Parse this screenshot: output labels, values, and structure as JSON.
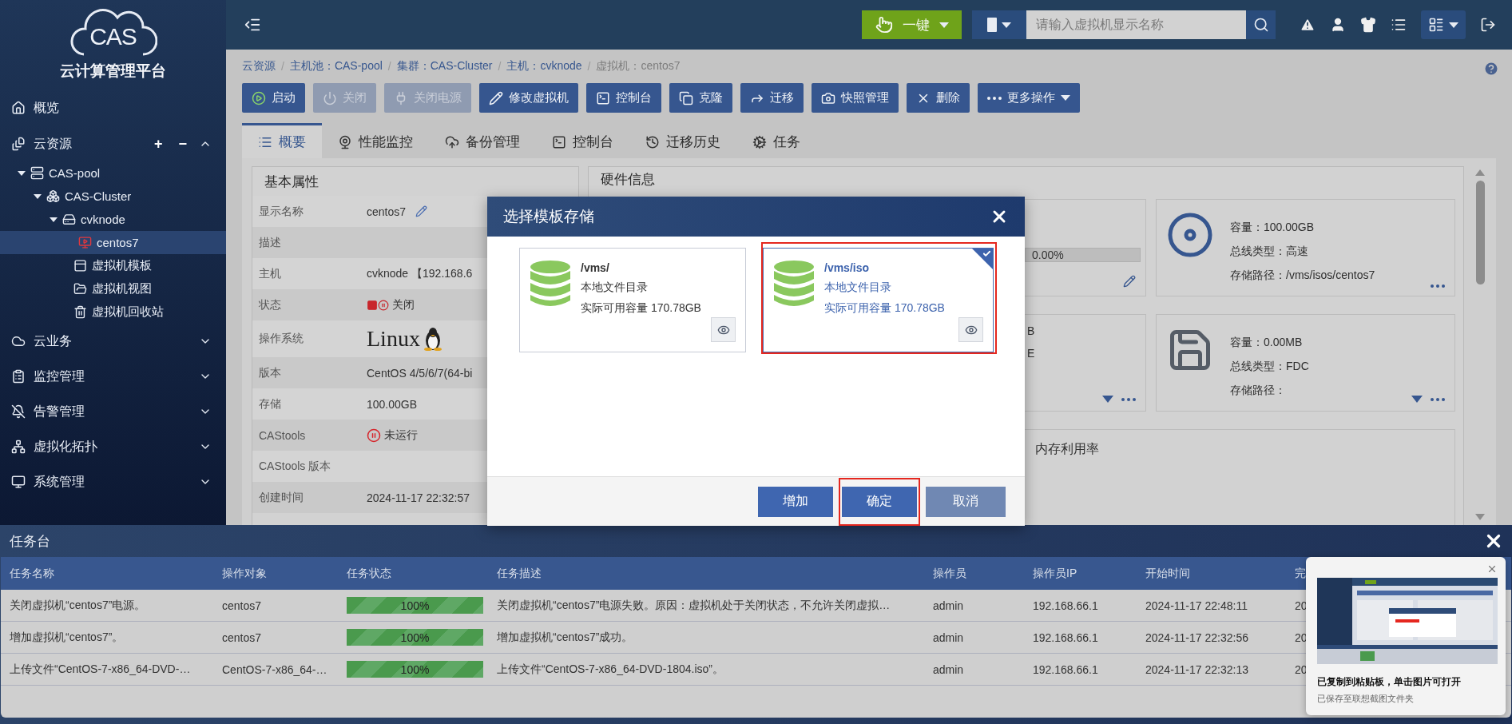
{
  "sidebar": {
    "logo": "CAS",
    "title": "云计算管理平台",
    "nav": [
      {
        "label": "概览"
      },
      {
        "label": "云资源",
        "expanded": true,
        "actions": [
          "+",
          "−"
        ],
        "children": [
          {
            "label": "CAS-pool",
            "selected": false,
            "expanded": true,
            "children": [
              {
                "label": "CAS-Cluster",
                "selected": false,
                "expanded": true,
                "children": [
                  {
                    "label": "cvknode",
                    "selected": false,
                    "expanded": true,
                    "children": [
                      {
                        "label": "centos7",
                        "selected": true
                      }
                    ]
                  }
                ]
              }
            ]
          },
          {
            "label": "虚拟机模板",
            "selected": false
          },
          {
            "label": "虚拟机视图",
            "selected": false
          },
          {
            "label": "虚拟机回收站",
            "selected": false
          }
        ]
      },
      {
        "label": "云业务",
        "expanded": false
      },
      {
        "label": "监控管理",
        "expanded": false
      },
      {
        "label": "告警管理",
        "expanded": false
      },
      {
        "label": "虚拟化拓扑",
        "expanded": false
      },
      {
        "label": "系统管理",
        "expanded": false
      }
    ]
  },
  "topbar": {
    "one_click": "一键",
    "search": {
      "placeholder": "请输入虚拟机显示名称"
    }
  },
  "breadcrumb": {
    "separator": "/",
    "items": [
      "云资源",
      "主机池：CAS-pool",
      "集群：CAS-Cluster",
      "主机：cvknode",
      "虚拟机：centos7"
    ]
  },
  "toolbar": [
    {
      "label": "启动",
      "disabled": false
    },
    {
      "label": "关闭",
      "disabled": true
    },
    {
      "label": "关闭电源",
      "disabled": true
    },
    {
      "label": "修改虚拟机",
      "disabled": false
    },
    {
      "label": "控制台",
      "disabled": false
    },
    {
      "label": "克隆",
      "disabled": false
    },
    {
      "label": "迁移",
      "disabled": false
    },
    {
      "label": "快照管理",
      "disabled": false
    },
    {
      "label": "删除",
      "disabled": false
    },
    {
      "label": "更多操作",
      "disabled": false
    }
  ],
  "tabs": [
    {
      "label": "概要",
      "selected": true
    },
    {
      "label": "性能监控",
      "selected": false
    },
    {
      "label": "备份管理",
      "selected": false
    },
    {
      "label": "控制台",
      "selected": false
    },
    {
      "label": "迁移历史",
      "selected": false
    },
    {
      "label": "任务",
      "selected": false
    }
  ],
  "basic": {
    "title": "基本属性",
    "rows": [
      {
        "label": "显示名称",
        "value": "centos7",
        "kind": "editable"
      },
      {
        "label": "描述",
        "kind": "text"
      },
      {
        "label": "主机",
        "value": "cvknode 【192.168.6",
        "kind": "text"
      },
      {
        "label": "状态",
        "value": "关闭",
        "kind": "vm-state"
      },
      {
        "label": "操作系统",
        "value": "Linux",
        "kind": "os"
      },
      {
        "label": "版本",
        "value": "CentOS 4/5/6/7(64-bi",
        "kind": "text"
      },
      {
        "label": "存储",
        "value": "100.00GB",
        "kind": "text"
      },
      {
        "label": "CAStools",
        "value": "未运行",
        "kind": "tools-state"
      },
      {
        "label": "CAStools 版本",
        "kind": "text"
      },
      {
        "label": "创建时间",
        "value": "2024-11-17 22:32:57",
        "kind": "text"
      }
    ]
  },
  "hardware": {
    "title": "硬件信息",
    "cpu_card": {
      "reading": "0.00%",
      "level": 0
    },
    "disk_card": {
      "fragments": [
        "B",
        "E"
      ]
    },
    "cards": [
      {
        "kind": "cdrom",
        "lines": [
          "容量：100.00GB",
          "总线类型：高速",
          "存储路径：/vms/isos/centos7"
        ]
      },
      {
        "kind": "floppy",
        "lines": [
          "容量：0.00MB",
          "总线类型：FDC",
          "存储路径："
        ]
      }
    ],
    "memory_title": "内存利用率"
  },
  "dialog": {
    "title": "选择模板存储",
    "storages": [
      {
        "name": "/vms/",
        "type": "本地文件目录",
        "capacity": "实际可用容量 170.78GB",
        "selected": false,
        "annotated": false
      },
      {
        "name": "/vms/iso",
        "type": "本地文件目录",
        "capacity": "实际可用容量 170.78GB",
        "selected": true,
        "annotated": true
      }
    ],
    "buttons": [
      {
        "label": "增加",
        "kind": "primary",
        "annotated": false
      },
      {
        "label": "确定",
        "kind": "primary",
        "annotated": true
      },
      {
        "label": "取消",
        "kind": "secondary",
        "annotated": false
      }
    ]
  },
  "tasks": {
    "title": "任务台",
    "columns": [
      "任务名称",
      "操作对象",
      "任务状态",
      "任务描述",
      "操作员",
      "操作员IP",
      "开始时间",
      "完"
    ],
    "rows": [
      {
        "name": "关闭虚拟机“centos7”电源。",
        "target": "centos7",
        "status": {
          "level": 1,
          "text": "100%"
        },
        "description": "关闭虚拟机“centos7”电源失败。原因：虚拟机处于关闭状态，不允许关闭虚拟…",
        "operator": "admin",
        "ip": "192.168.66.1",
        "start": "2024-11-17 22:48:11",
        "column_8": "20"
      },
      {
        "name": "增加虚拟机“centos7”。",
        "target": "centos7",
        "status": {
          "level": 1,
          "text": "100%"
        },
        "description": "增加虚拟机“centos7”成功。",
        "operator": "admin",
        "ip": "192.168.66.1",
        "start": "2024-11-17 22:32:56",
        "column_8": "20"
      },
      {
        "name": "上传文件“CentOS-7-x86_64-DVD-…",
        "target": "CentOS-7-x86_64-…",
        "status": {
          "level": 1,
          "text": "100%"
        },
        "description": "上传文件“CentOS-7-x86_64-DVD-1804.iso”。",
        "operator": "admin",
        "ip": "192.168.66.1",
        "start": "2024-11-17 22:32:13",
        "column_8": "20"
      }
    ]
  },
  "notification": {
    "kind": "picture",
    "message": "已复制到粘贴板，单击图片可打开",
    "detail": "已保存至联想截图文件夹"
  }
}
